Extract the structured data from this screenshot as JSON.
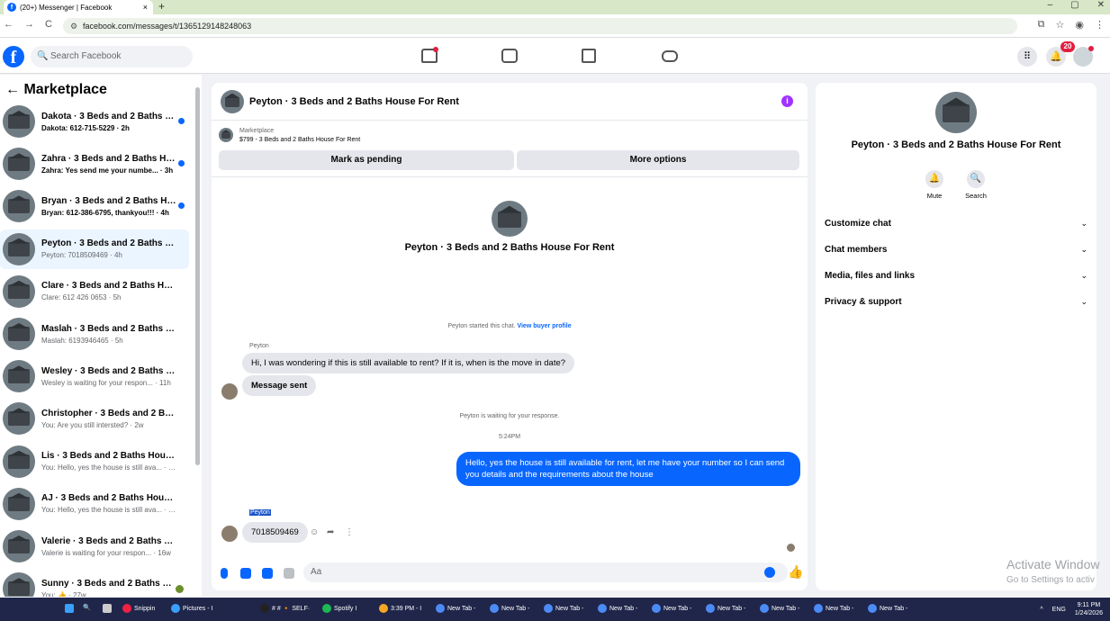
{
  "browser": {
    "tab_title": "(20+) Messenger | Facebook",
    "tab_close": "×",
    "new_tab": "+",
    "window_controls": [
      "–",
      "▢",
      "✕"
    ],
    "url": "facebook.com/messages/t/1365129148248063",
    "nav": [
      "←",
      "→",
      "C"
    ],
    "right_icons": [
      "⧉",
      "☆",
      "◉",
      "⋮"
    ]
  },
  "fb_header": {
    "logo": "f",
    "search_placeholder": "Search Facebook",
    "notification_count": "20",
    "menu_icon": "grid-icon",
    "bell_icon": "bell-icon"
  },
  "sidebar": {
    "title": "← Marketplace",
    "conversations": [
      {
        "name": "Dakota · 3 Beds and 2 Baths H...",
        "sub": "Dakota: 612-715-5229 · 2h",
        "unread": true
      },
      {
        "name": "Zahra · 3 Beds and 2 Baths Ho...",
        "sub": "Zahra: Yes send me your numbe... · 3h",
        "unread": true
      },
      {
        "name": "Bryan · 3 Beds and 2 Baths Ho...",
        "sub": "Bryan: 612-386-6795, thankyou!!! · 4h",
        "unread": true
      },
      {
        "name": "Peyton · 3 Beds and 2 Baths Hou...",
        "sub": "Peyton: 7018509469 · 4h",
        "unread": false
      },
      {
        "name": "Clare · 3 Beds and 2 Baths Hous...",
        "sub": "Clare: 612 426 0653 · 5h",
        "unread": false
      },
      {
        "name": "Maslah · 3 Beds and 2 Baths Ho...",
        "sub": "Maslah: 6193946465 · 5h",
        "unread": false
      },
      {
        "name": "Wesley · 3 Beds and 2 Baths Ho...",
        "sub": "Wesley is waiting for your respon... · 11h",
        "unread": false
      },
      {
        "name": "Christopher · 3 Beds and 2 Baths...",
        "sub": "You: Are you still intersted? · 2w",
        "unread": false
      },
      {
        "name": "Lis · 3 Beds and 2 Baths House F...",
        "sub": "You: Hello, yes the house is still ava... · 2w",
        "unread": false
      },
      {
        "name": "AJ · 3 Beds and 2 Baths House F...",
        "sub": "You: Hello, yes the house is still ava... · 2w",
        "unread": false
      },
      {
        "name": "Valerie · 3 Beds and 2 Baths Hou...",
        "sub": "Valerie is waiting for your respon... · 16w",
        "unread": false
      },
      {
        "name": "Sunny · 3 Beds and 2 Baths H...",
        "sub": "You: 👍 · 27w",
        "unread": false
      }
    ]
  },
  "chat": {
    "title": "Peyton · 3 Beds and 2 Baths House For Rent",
    "info_icon": "i",
    "marketplace_label": "Marketplace",
    "item": "$799 - 3 Beds and 2 Baths House For Rent",
    "btn_pending": "Mark as pending",
    "btn_options": "More options",
    "big_title": "Peyton · 3 Beds and 2 Baths House For Rent",
    "started_text": "Peyton started this chat.",
    "view_profile": "View buyer profile",
    "sender1": "Peyton",
    "msg1": "Hi, I was wondering if this is still available to rent? If it is, when is the move in date?",
    "msg2": "Message sent",
    "waiting": "Peyton is waiting for your response.",
    "time": "5:24PM",
    "msg_out": "Hello, yes the house is still available for rent, let me have your number so I can send you details and the requirements about the house",
    "sender2": "Peyton",
    "msg3": "7018509469",
    "react_icons": [
      "☺",
      "➦",
      "⋮"
    ],
    "composer_placeholder": "Aa",
    "like_icon": "👍"
  },
  "right_panel": {
    "name": "Peyton · 3 Beds and 2 Baths House For Rent",
    "mute_label": "Mute",
    "search_label": "Search",
    "rows": [
      {
        "label": "Customize chat",
        "chev": "⌄"
      },
      {
        "label": "Chat members",
        "chev": "⌄"
      },
      {
        "label": "Media, files and links",
        "chev": "⌄"
      },
      {
        "label": "Privacy & support",
        "chev": "⌄"
      }
    ]
  },
  "watermark": {
    "line1": "Activate Window",
    "line2": "Go to Settings to activ"
  },
  "taskbar": {
    "apps": [
      "Snippin",
      "Pictures - I",
      "# # 🔸 SELF·",
      "Spotify I",
      "3:39 PM - I",
      "New Tab -",
      "New Tab -",
      "New Tab -",
      "New Tab -",
      "New Tab -",
      "New Tab -",
      "New Tab -",
      "New Tab -",
      "New Tab -"
    ],
    "lang": "ENG",
    "time": "9:11 PM",
    "date": "1/24/2026"
  }
}
